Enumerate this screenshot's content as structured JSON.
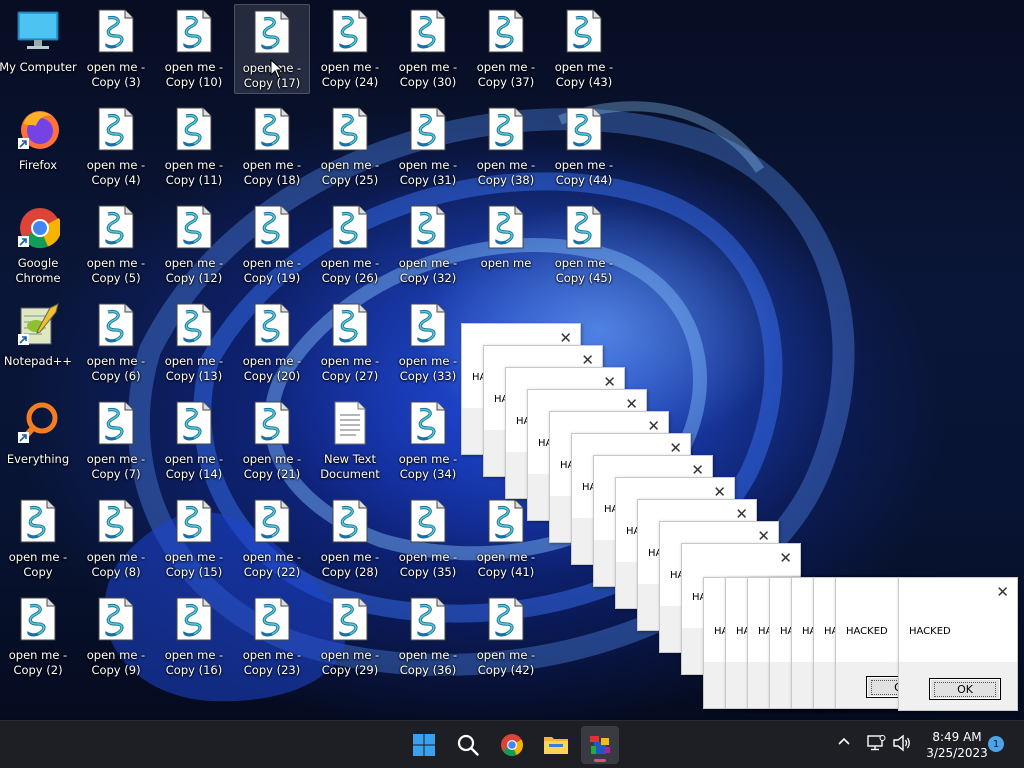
{
  "desktop": {
    "shortcuts": [
      {
        "label": "My Computer",
        "icon": "computer-icon",
        "col": 0,
        "row": 0
      },
      {
        "label": "Firefox",
        "icon": "firefox-icon",
        "col": 0,
        "row": 1
      },
      {
        "label": "Google Chrome",
        "icon": "chrome-icon",
        "col": 0,
        "row": 2
      },
      {
        "label": "Notepad++",
        "icon": "notepadpp-icon",
        "col": 0,
        "row": 3
      },
      {
        "label": "Everything",
        "icon": "everything-icon",
        "col": 0,
        "row": 4
      },
      {
        "label": "open me - Copy",
        "icon": "script-file-icon",
        "col": 0,
        "row": 5
      },
      {
        "label": "open me - Copy (2)",
        "icon": "script-file-icon",
        "col": 0,
        "row": 6
      },
      {
        "label": "open me - Copy (3)",
        "icon": "script-file-icon",
        "col": 1,
        "row": 0
      },
      {
        "label": "open me - Copy (4)",
        "icon": "script-file-icon",
        "col": 1,
        "row": 1
      },
      {
        "label": "open me - Copy (5)",
        "icon": "script-file-icon",
        "col": 1,
        "row": 2
      },
      {
        "label": "open me - Copy (6)",
        "icon": "script-file-icon",
        "col": 1,
        "row": 3
      },
      {
        "label": "open me - Copy (7)",
        "icon": "script-file-icon",
        "col": 1,
        "row": 4
      },
      {
        "label": "open me - Copy (8)",
        "icon": "script-file-icon",
        "col": 1,
        "row": 5
      },
      {
        "label": "open me - Copy (9)",
        "icon": "script-file-icon",
        "col": 1,
        "row": 6
      },
      {
        "label": "open me - Copy (10)",
        "icon": "script-file-icon",
        "col": 2,
        "row": 0
      },
      {
        "label": "open me - Copy (11)",
        "icon": "script-file-icon",
        "col": 2,
        "row": 1
      },
      {
        "label": "open me - Copy (12)",
        "icon": "script-file-icon",
        "col": 2,
        "row": 2
      },
      {
        "label": "open me - Copy (13)",
        "icon": "script-file-icon",
        "col": 2,
        "row": 3
      },
      {
        "label": "open me - Copy (14)",
        "icon": "script-file-icon",
        "col": 2,
        "row": 4
      },
      {
        "label": "open me - Copy (15)",
        "icon": "script-file-icon",
        "col": 2,
        "row": 5
      },
      {
        "label": "open me - Copy (16)",
        "icon": "script-file-icon",
        "col": 2,
        "row": 6
      },
      {
        "label": "open me - Copy (17)",
        "icon": "script-file-icon",
        "col": 3,
        "row": 0,
        "selected": true
      },
      {
        "label": "open me - Copy (18)",
        "icon": "script-file-icon",
        "col": 3,
        "row": 1
      },
      {
        "label": "open me - Copy (19)",
        "icon": "script-file-icon",
        "col": 3,
        "row": 2
      },
      {
        "label": "open me - Copy (20)",
        "icon": "script-file-icon",
        "col": 3,
        "row": 3
      },
      {
        "label": "open me - Copy (21)",
        "icon": "script-file-icon",
        "col": 3,
        "row": 4
      },
      {
        "label": "open me - Copy (22)",
        "icon": "script-file-icon",
        "col": 3,
        "row": 5
      },
      {
        "label": "open me - Copy (23)",
        "icon": "script-file-icon",
        "col": 3,
        "row": 6
      },
      {
        "label": "open me - Copy (24)",
        "icon": "script-file-icon",
        "col": 4,
        "row": 0
      },
      {
        "label": "open me - Copy (25)",
        "icon": "script-file-icon",
        "col": 4,
        "row": 1
      },
      {
        "label": "open me - Copy (26)",
        "icon": "script-file-icon",
        "col": 4,
        "row": 2
      },
      {
        "label": "open me - Copy (27)",
        "icon": "script-file-icon",
        "col": 4,
        "row": 3
      },
      {
        "label": "New Text Document",
        "icon": "text-document-icon",
        "col": 4,
        "row": 4
      },
      {
        "label": "open me - Copy (28)",
        "icon": "script-file-icon",
        "col": 4,
        "row": 5
      },
      {
        "label": "open me - Copy (29)",
        "icon": "script-file-icon",
        "col": 4,
        "row": 6
      },
      {
        "label": "open me - Copy (30)",
        "icon": "script-file-icon",
        "col": 5,
        "row": 0
      },
      {
        "label": "open me - Copy (31)",
        "icon": "script-file-icon",
        "col": 5,
        "row": 1
      },
      {
        "label": "open me - Copy (32)",
        "icon": "script-file-icon",
        "col": 5,
        "row": 2
      },
      {
        "label": "open me - Copy (33)",
        "icon": "script-file-icon",
        "col": 5,
        "row": 3
      },
      {
        "label": "open me - Copy (34)",
        "icon": "script-file-icon",
        "col": 5,
        "row": 4
      },
      {
        "label": "open me - Copy (35)",
        "icon": "script-file-icon",
        "col": 5,
        "row": 5
      },
      {
        "label": "open me - Copy (36)",
        "icon": "script-file-icon",
        "col": 5,
        "row": 6
      },
      {
        "label": "open me - Copy (37)",
        "icon": "script-file-icon",
        "col": 6,
        "row": 0
      },
      {
        "label": "open me - Copy (38)",
        "icon": "script-file-icon",
        "col": 6,
        "row": 1
      },
      {
        "label": "open me",
        "icon": "script-file-icon",
        "col": 6,
        "row": 2
      },
      {
        "label": "open me - Copy (41)",
        "icon": "script-file-icon",
        "col": 6,
        "row": 5
      },
      {
        "label": "open me - Copy (42)",
        "icon": "script-file-icon",
        "col": 6,
        "row": 6
      },
      {
        "label": "open me - Copy (43)",
        "icon": "script-file-icon",
        "col": 7,
        "row": 0
      },
      {
        "label": "open me - Copy (44)",
        "icon": "script-file-icon",
        "col": 7,
        "row": 1
      },
      {
        "label": "open me - Copy (45)",
        "icon": "script-file-icon",
        "col": 7,
        "row": 2
      }
    ]
  },
  "dialogs": {
    "message": "HACKED",
    "close_glyph": "✕",
    "ok_label": "OK",
    "stack_count": 19
  },
  "taskbar": {
    "apps": [
      {
        "name": "start-button",
        "icon": "windows-start-icon"
      },
      {
        "name": "search-button",
        "icon": "search-icon"
      },
      {
        "name": "chrome-taskbar-button",
        "icon": "chrome-icon"
      },
      {
        "name": "file-explorer-button",
        "icon": "folder-icon"
      },
      {
        "name": "running-app-button",
        "icon": "colorful-app-icon",
        "active": true
      }
    ],
    "tray": {
      "overflow_glyph": "^",
      "time": "8:49 AM",
      "date": "3/25/2023",
      "notification_count": "1"
    }
  },
  "colors": {
    "accent": "#0078d4",
    "taskbar": "#1e1f24",
    "notification_badge": "#4ca3e6",
    "active_indicator": "#e05070"
  }
}
